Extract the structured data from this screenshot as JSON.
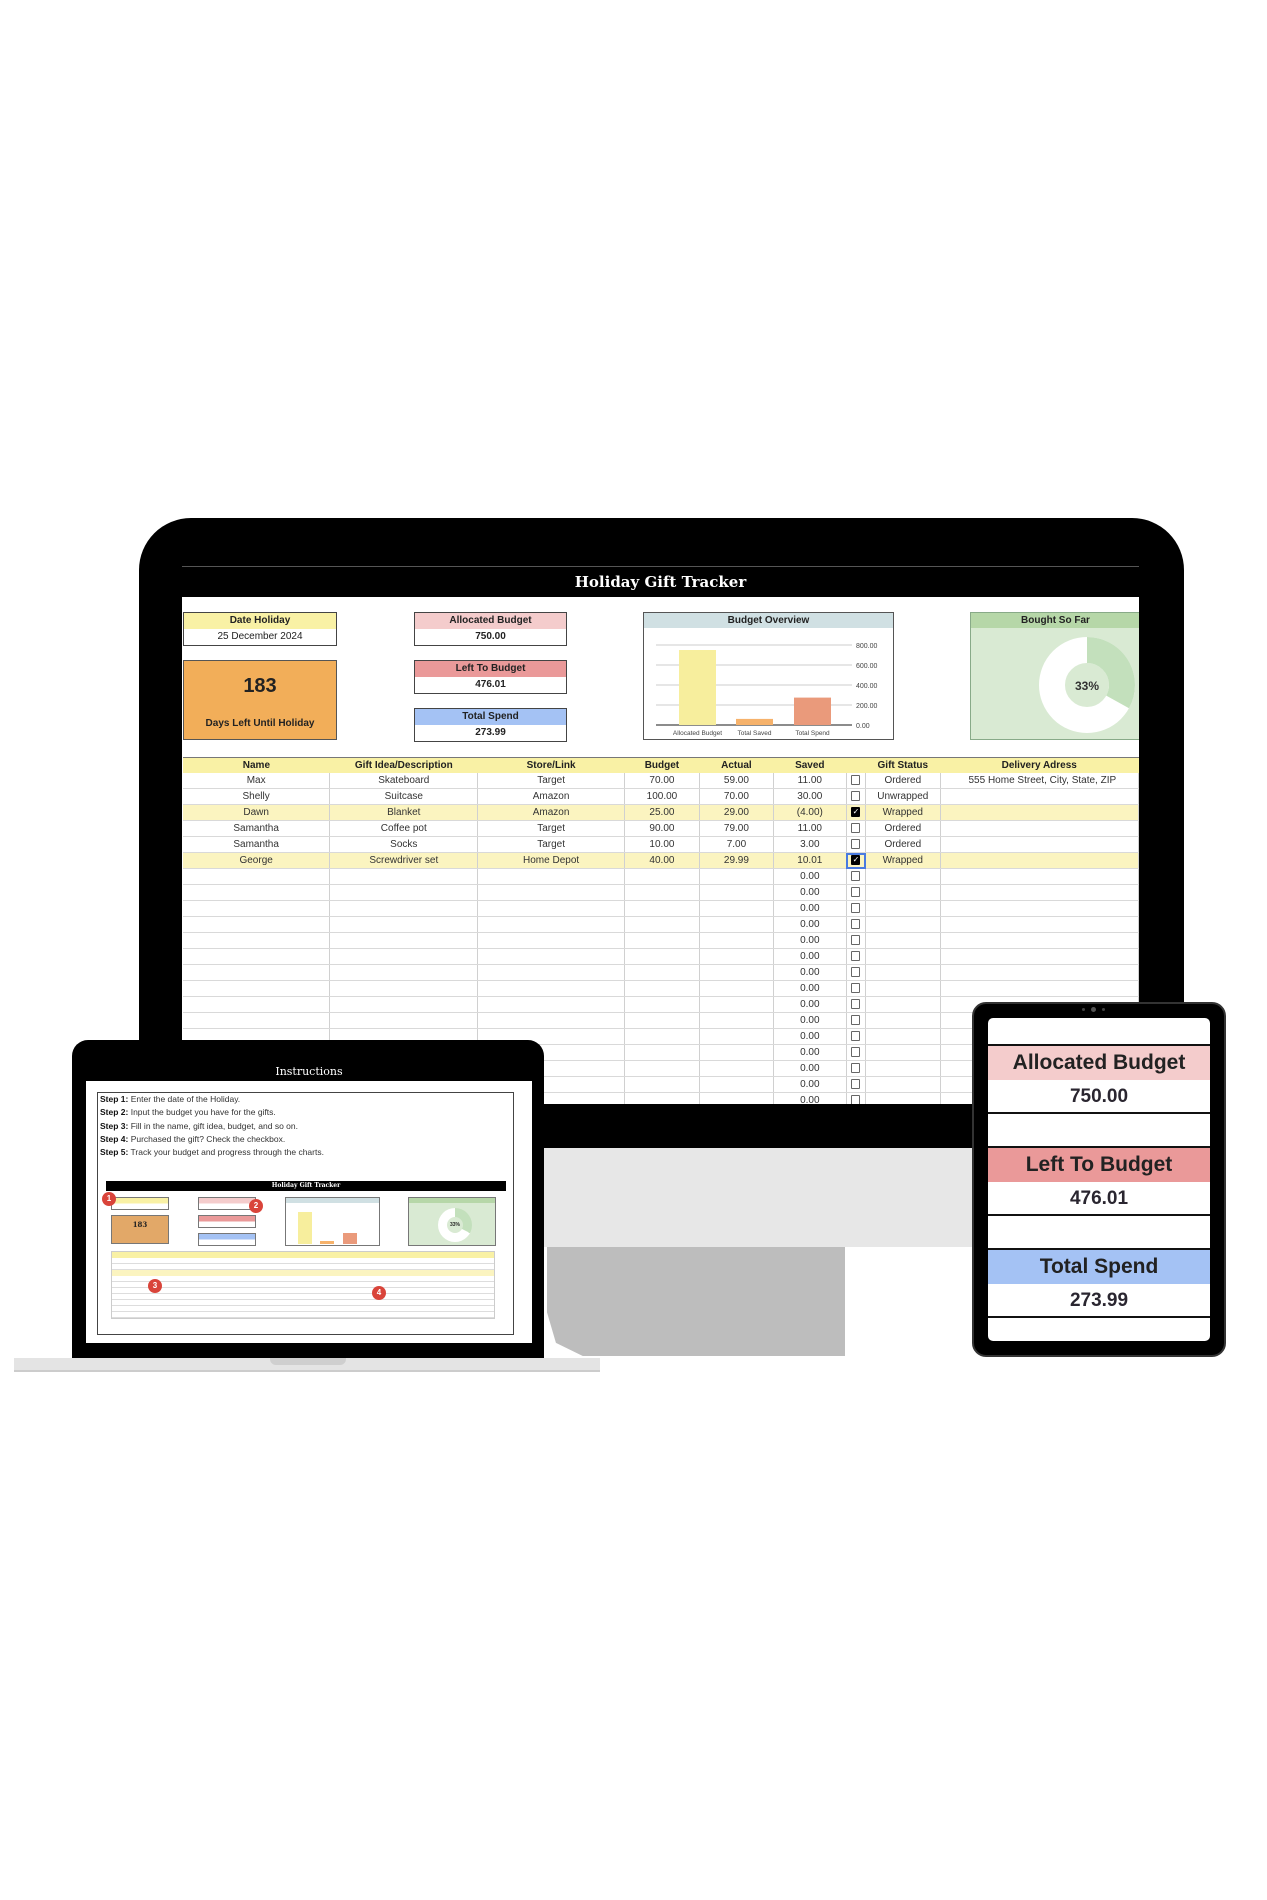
{
  "tracker": {
    "title": "Holiday Gift Tracker",
    "date_holiday_label": "Date Holiday",
    "date_holiday_value": "25 December 2024",
    "days_left_value": "183",
    "days_left_label": "Days Left Until Holiday",
    "allocated_label": "Allocated Budget",
    "allocated_value": "750.00",
    "left_label": "Left To Budget",
    "left_value": "476.01",
    "spend_label": "Total Spend",
    "spend_value": "273.99",
    "overview_title": "Budget Overview",
    "bought_title": "Bought So Far",
    "bought_pct_label": "33%",
    "bought_fraction": 0.33,
    "columns": [
      "Name",
      "Gift Idea/Description",
      "Store/Link",
      "Budget",
      "Actual",
      "Saved",
      "",
      "Gift Status",
      "Delivery Adress"
    ],
    "rows": [
      {
        "name": "Max",
        "gift": "Skateboard",
        "store": "Target",
        "budget": "70.00",
        "actual": "59.00",
        "saved": "11.00",
        "checked": false,
        "status": "Ordered",
        "address": "555 Home Street, City, State, ZIP"
      },
      {
        "name": "Shelly",
        "gift": "Suitcase",
        "store": "Amazon",
        "budget": "100.00",
        "actual": "70.00",
        "saved": "30.00",
        "checked": false,
        "status": "Unwrapped",
        "address": ""
      },
      {
        "name": "Dawn",
        "gift": "Blanket",
        "store": "Amazon",
        "budget": "25.00",
        "actual": "29.00",
        "saved": "(4.00)",
        "checked": true,
        "status": "Wrapped",
        "address": ""
      },
      {
        "name": "Samantha",
        "gift": "Coffee pot",
        "store": "Target",
        "budget": "90.00",
        "actual": "79.00",
        "saved": "11.00",
        "checked": false,
        "status": "Ordered",
        "address": ""
      },
      {
        "name": "Samantha",
        "gift": "Socks",
        "store": "Target",
        "budget": "10.00",
        "actual": "7.00",
        "saved": "3.00",
        "checked": false,
        "status": "Ordered",
        "address": ""
      },
      {
        "name": "George",
        "gift": "Screwdriver set",
        "store": "Home Depot",
        "budget": "40.00",
        "actual": "29.99",
        "saved": "10.01",
        "checked": true,
        "status": "Wrapped",
        "address": ""
      }
    ],
    "empty_saved_value": "0.00",
    "empty_row_count": 15
  },
  "chart_data": {
    "type": "bar",
    "title": "Budget Overview",
    "categories": [
      "Allocated Budget",
      "Total Saved",
      "Total Spend"
    ],
    "values": [
      750.0,
      61.01,
      273.99
    ],
    "colors": [
      "#f7ee9d",
      "#f6b26b",
      "#ea9a7b"
    ],
    "yticks": [
      "0.00",
      "200.00",
      "400.00",
      "600.00",
      "800.00"
    ],
    "ylim": [
      0,
      800
    ],
    "grid": true
  },
  "laptop": {
    "title": "Instructions",
    "steps": [
      {
        "label": "Step 1:",
        "text": " Enter the date of the Holiday."
      },
      {
        "label": "Step 2:",
        "text": " Input the budget you have for the gifts."
      },
      {
        "label": "Step 3:",
        "text": " Fill in the name, gift idea, budget, and so on."
      },
      {
        "label": "Step 4:",
        "text": " Purchased the gift? Check the checkbox."
      },
      {
        "label": "Step 5:",
        "text": " Track your budget and progress through the charts."
      }
    ],
    "mini_title": "Holiday Gift Tracker",
    "mini_days": "183",
    "mini_pct": "33%",
    "badges": [
      "1",
      "2",
      "3",
      "4"
    ]
  },
  "tablet": {
    "allocated_label": "Allocated Budget",
    "allocated_value": "750.00",
    "left_label": "Left To Budget",
    "left_value": "476.01",
    "spend_label": "Total Spend",
    "spend_value": "273.99"
  },
  "colors": {
    "yellow": "#f9f1a5",
    "pink": "#f4cccc",
    "red": "#ea9999",
    "blue": "#a4c2f4",
    "orange": "#f2ae59",
    "green": "#d9ead3"
  }
}
